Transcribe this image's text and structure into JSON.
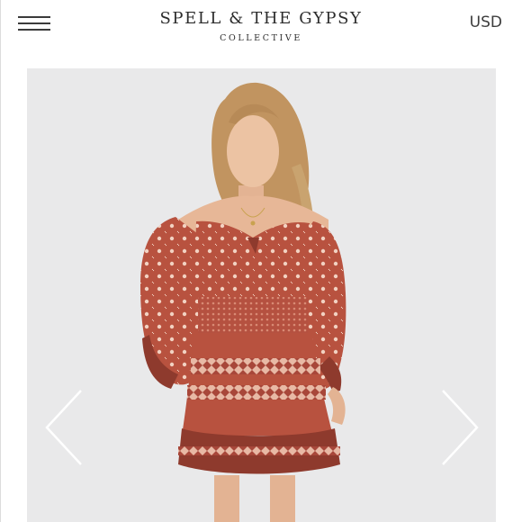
{
  "header": {
    "brand_name": "SPELL & THE GYPSY",
    "brand_sub": "COLLECTIVE",
    "currency": "USD"
  },
  "icons": {
    "menu": "hamburger-icon",
    "prev": "chevron-left-icon",
    "next": "chevron-right-icon"
  },
  "colors": {
    "background": "#ffffff",
    "photo_background": "#e9e9ea",
    "dress_primary": "#b8523f",
    "dress_dark": "#8e3a2d",
    "pattern": "#f2d2c2"
  }
}
